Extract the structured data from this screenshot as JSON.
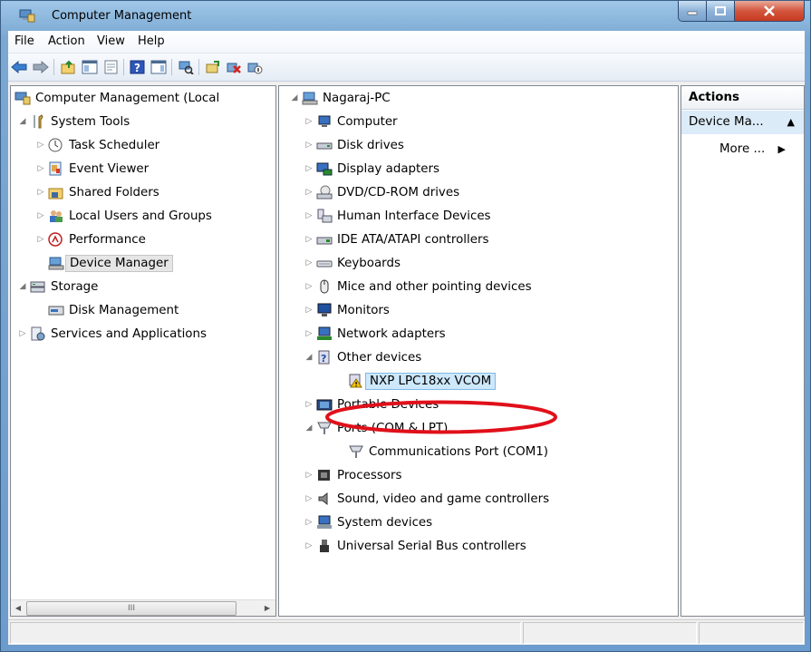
{
  "window": {
    "title": "Computer Management",
    "app_icon": "computer-management-icon"
  },
  "menu": {
    "items": [
      "File",
      "Action",
      "View",
      "Help"
    ]
  },
  "toolbar": {
    "buttons": [
      "back-icon",
      "forward-icon",
      "up-folder-icon",
      "show-hide-tree-icon",
      "properties-icon",
      "help-icon",
      "show-hide-action-pane-icon",
      "scan-hardware-icon",
      "update-driver-icon",
      "uninstall-icon",
      "disable-device-icon"
    ]
  },
  "left_tree": {
    "root": "Computer Management (Local",
    "items": [
      {
        "label": "System Tools",
        "icon": "tools-icon",
        "expanded": true
      },
      {
        "label": "Task Scheduler",
        "icon": "clock-icon"
      },
      {
        "label": "Event Viewer",
        "icon": "event-viewer-icon"
      },
      {
        "label": "Shared Folders",
        "icon": "shared-folders-icon"
      },
      {
        "label": "Local Users and Groups",
        "icon": "users-icon"
      },
      {
        "label": "Performance",
        "icon": "performance-icon"
      },
      {
        "label": "Device Manager",
        "icon": "device-manager-icon",
        "selected": true
      },
      {
        "label": "Storage",
        "icon": "storage-icon",
        "expanded": true
      },
      {
        "label": "Disk Management",
        "icon": "disk-management-icon"
      },
      {
        "label": "Services and Applications",
        "icon": "services-icon"
      }
    ],
    "scroll_marker": "III"
  },
  "device_tree": {
    "root": "Nagaraj-PC",
    "items": [
      {
        "label": "Computer",
        "icon": "computer-icon"
      },
      {
        "label": "Disk drives",
        "icon": "disk-drive-icon"
      },
      {
        "label": "Display adapters",
        "icon": "display-adapter-icon"
      },
      {
        "label": "DVD/CD-ROM drives",
        "icon": "dvd-drive-icon"
      },
      {
        "label": "Human Interface Devices",
        "icon": "hid-icon"
      },
      {
        "label": "IDE ATA/ATAPI controllers",
        "icon": "ide-controller-icon"
      },
      {
        "label": "Keyboards",
        "icon": "keyboard-icon"
      },
      {
        "label": "Mice and other pointing devices",
        "icon": "mouse-icon"
      },
      {
        "label": "Monitors",
        "icon": "monitor-icon"
      },
      {
        "label": "Network adapters",
        "icon": "network-adapter-icon"
      },
      {
        "label": "Other devices",
        "icon": "unknown-device-icon",
        "expanded": true
      },
      {
        "label": "NXP LPC18xx VCOM",
        "icon": "warning-device-icon",
        "highlighted": true
      },
      {
        "label": "Portable Devices",
        "icon": "portable-device-icon"
      },
      {
        "label": "Ports (COM & LPT)",
        "icon": "port-icon",
        "expanded": true
      },
      {
        "label": "Communications Port (COM1)",
        "icon": "port-icon"
      },
      {
        "label": "Processors",
        "icon": "processor-icon"
      },
      {
        "label": "Sound, video and game controllers",
        "icon": "sound-icon"
      },
      {
        "label": "System devices",
        "icon": "system-device-icon"
      },
      {
        "label": "Universal Serial Bus controllers",
        "icon": "usb-icon"
      }
    ]
  },
  "actions": {
    "header": "Actions",
    "section": "Device Ma...",
    "more": "More ..."
  },
  "colors": {
    "annotation_red": "#e0101a",
    "selection": "#cde8fb"
  }
}
